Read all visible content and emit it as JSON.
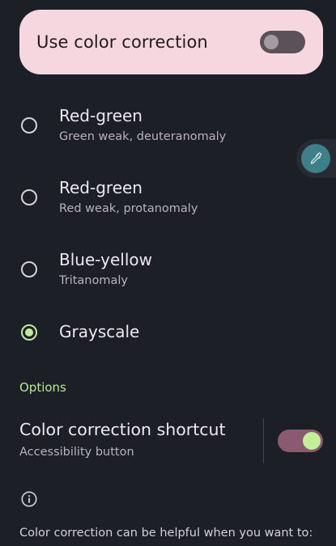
{
  "main_toggle": {
    "label": "Use color correction",
    "state": "off"
  },
  "modes": [
    {
      "title": "Red-green",
      "subtitle": "Green weak, deuteranomaly",
      "selected": false
    },
    {
      "title": "Red-green",
      "subtitle": "Red weak, protanomaly",
      "selected": false
    },
    {
      "title": "Blue-yellow",
      "subtitle": "Tritanomaly",
      "selected": false
    },
    {
      "title": "Grayscale",
      "subtitle": "",
      "selected": true
    }
  ],
  "floating_button": {
    "icon": "eyedropper-icon"
  },
  "options": {
    "section_title": "Options",
    "shortcut": {
      "title": "Color correction shortcut",
      "subtitle": "Accessibility button",
      "state": "on"
    }
  },
  "info": {
    "icon": "info-icon",
    "text": "Color correction can be helpful when you want to:"
  },
  "colors": {
    "background": "#1d1f27",
    "card": "#f6d7e0",
    "accent_green": "#c0e8a0",
    "switch_on_track": "#8a5a6e",
    "float_button": "#3e7f88"
  }
}
